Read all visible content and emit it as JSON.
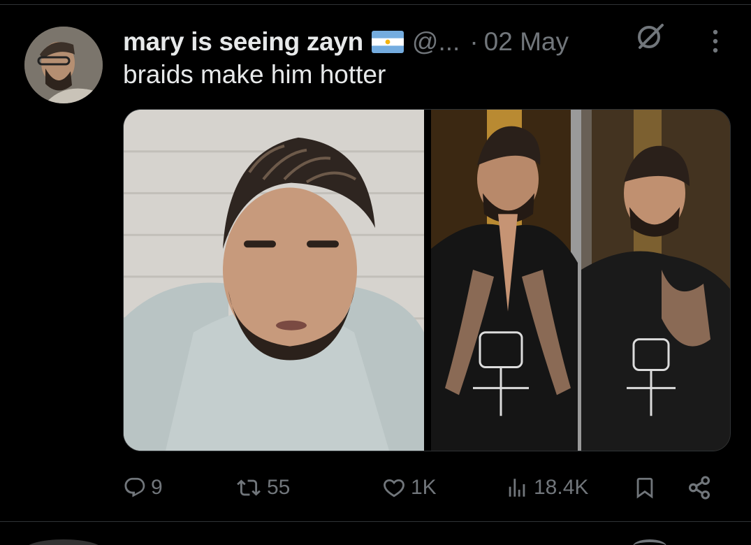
{
  "tweet": {
    "display_name": "mary is seeing zayn",
    "flag_icon": "argentina-flag-icon",
    "handle": "@...",
    "separator": "·",
    "date": "02 May",
    "text": "braids make him hotter",
    "media": [
      {
        "name": "photo-left",
        "description_icon": "photo"
      },
      {
        "name": "photo-right",
        "description_icon": "photo"
      }
    ]
  },
  "actions": {
    "replies": "9",
    "retweets": "55",
    "likes": "1K",
    "views": "18.4K"
  },
  "colors": {
    "background": "#000000",
    "text_primary": "#e7e9ea",
    "text_secondary": "#71767b",
    "divider": "#2f3336",
    "flag_blue": "#74acdf",
    "flag_sun": "#f6b40e"
  }
}
